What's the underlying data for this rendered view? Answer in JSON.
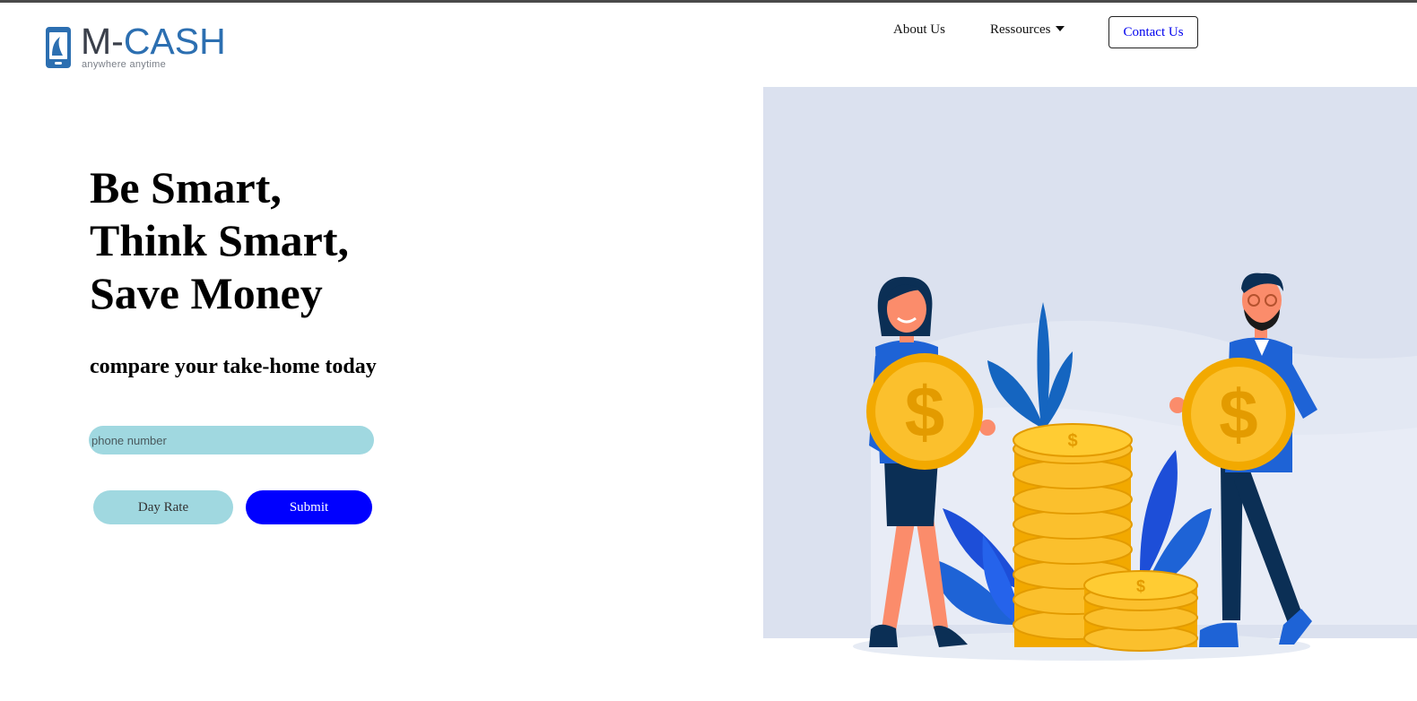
{
  "brand": {
    "name_prefix": "M",
    "name_dash": "-",
    "name_suffix": "CASH",
    "tagline": "anywhere anytime",
    "colors": {
      "dark": "#3a3f4a",
      "blue": "#2c6fb1"
    }
  },
  "nav": {
    "items": [
      {
        "label": "About Us"
      },
      {
        "label": "Ressources",
        "icon": "caret-down-icon"
      }
    ],
    "contact_label": "Contact Us"
  },
  "hero": {
    "title_lines": [
      "Be Smart,",
      "Think Smart,",
      "Save Money"
    ],
    "subtitle": "compare your take-home today"
  },
  "form": {
    "phone_placeholder": "phone number",
    "phone_value": "",
    "day_rate_label": "Day Rate",
    "submit_label": "Submit"
  },
  "colors": {
    "accent_blue": "#0000ff",
    "input_teal": "#a0d8e0",
    "illustration_bg": "#dbe1ef",
    "coin_gold": "#f7b516"
  }
}
